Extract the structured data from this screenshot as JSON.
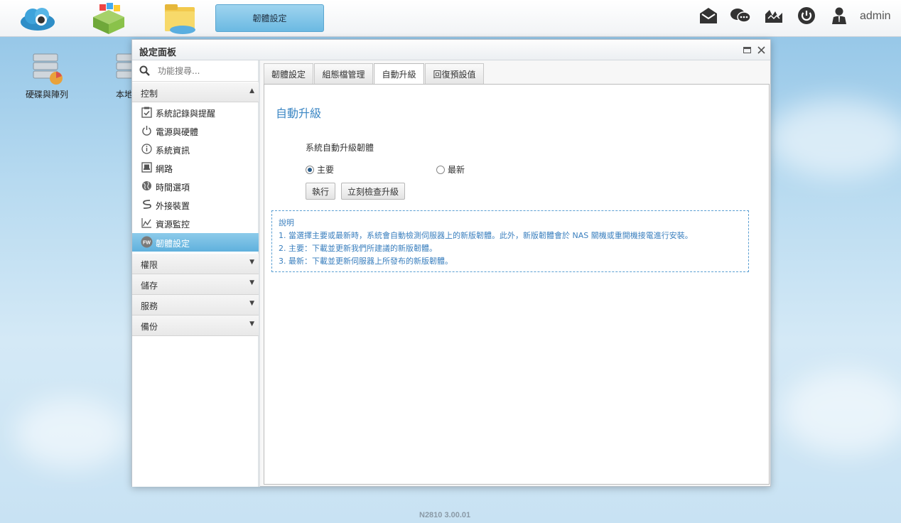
{
  "topbar": {
    "active_app_label": "韌體設定",
    "user": "admin"
  },
  "desktop": {
    "icons": [
      {
        "label": "硬碟與陣列"
      },
      {
        "label": "本地"
      }
    ]
  },
  "window": {
    "title": "設定面板"
  },
  "sidebar": {
    "search_placeholder": "功能搜尋...",
    "sections": [
      {
        "label": "控制",
        "arrow": "▲"
      },
      {
        "label": "權限",
        "arrow": "▼"
      },
      {
        "label": "儲存",
        "arrow": "▼"
      },
      {
        "label": "服務",
        "arrow": "▼"
      },
      {
        "label": "備份",
        "arrow": "▼"
      }
    ],
    "items": [
      {
        "label": "系統記錄與提醒",
        "icon": "checklist-icon"
      },
      {
        "label": "電源與硬體",
        "icon": "power-icon"
      },
      {
        "label": "系統資訊",
        "icon": "info-icon"
      },
      {
        "label": "網路",
        "icon": "network-icon"
      },
      {
        "label": "時間選項",
        "icon": "globe-icon"
      },
      {
        "label": "外接裝置",
        "icon": "usb-icon"
      },
      {
        "label": "資源監控",
        "icon": "chart-icon"
      },
      {
        "label": "韌體設定",
        "icon": "fw-icon",
        "active": true
      }
    ]
  },
  "tabs": [
    {
      "label": "韌體設定"
    },
    {
      "label": "組態檔管理"
    },
    {
      "label": "自動升級",
      "active": true
    },
    {
      "label": "回復預設值"
    }
  ],
  "content": {
    "title": "自動升級",
    "option_label": "系統自動升級韌體",
    "radio_main": "主要",
    "radio_latest": "最新",
    "selected": "主要",
    "btn_apply": "執行",
    "btn_check": "立刻檢查升級",
    "note": {
      "heading": "說明",
      "lines": [
        "1. 當選擇主要或最新時，系統會自動檢測伺服器上的新版韌體。此外，新版韌體會於 NAS 關機或重開機接電進行安裝。",
        "2. 主要：下載並更新我們所建議的新版韌體。",
        "3. 最新：下載並更新伺服器上所發布的新版韌體。"
      ]
    }
  },
  "footer": {
    "version": "N2810   3.00.01"
  },
  "colors": {
    "accent": "#3c87c4",
    "active_nav": "#5fb1dd",
    "note_border": "#5b9fd2"
  }
}
